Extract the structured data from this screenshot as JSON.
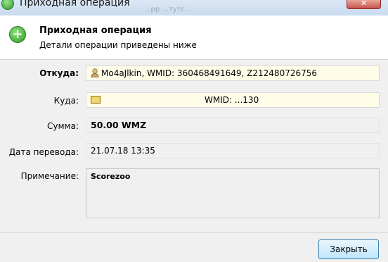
{
  "window": {
    "title": "Приходная операция",
    "ghost_text": "...рр   ...тутс...",
    "close_glyph": "✕"
  },
  "header": {
    "title": "Приходная операция",
    "subtitle": "Детали операции приведены ниже"
  },
  "fields": {
    "from": {
      "label": "Откуда:",
      "value": "Mo4aJlkin, WMID: 360468491649, Z212480726756"
    },
    "to": {
      "label": "Куда:",
      "value": "WMID: ...130"
    },
    "amount": {
      "label": "Сумма:",
      "value": "50.00 WMZ"
    },
    "date": {
      "label": "Дата перевода:",
      "value": "21.07.18 13:35"
    },
    "note": {
      "label": "Примечание:",
      "value": "Scorezoo"
    }
  },
  "footer": {
    "close_label": "Закрыть"
  },
  "icons": {
    "app": "green-plus-icon",
    "header": "green-plus-icon",
    "from": "person-icon",
    "to": "wallet-card-icon"
  },
  "colors": {
    "accent_green": "#2f9e2a",
    "field_yellow": "#fffde8",
    "button_blue": "#3c7fb1"
  }
}
